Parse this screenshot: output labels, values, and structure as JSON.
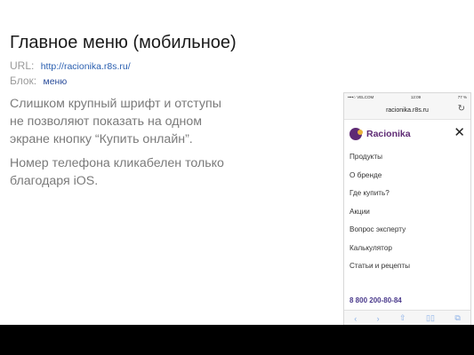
{
  "slide": {
    "title": "Главное меню (мобильное)",
    "url_label": "URL:",
    "url_value": "http://racionika.r8s.ru/",
    "block_label": "Блок:",
    "block_value": "меню",
    "paragraph1": "Слишком крупный шрифт и отступы не позволяют показать на одном экране кнопку “Купить онлайн”.",
    "paragraph2": "Номер телефона кликабелен только благодаря iOS."
  },
  "phone": {
    "status_left": "••••○ VELCOM",
    "status_time": "12:09",
    "status_right": "77 %",
    "domain": "racionika.r8s.ru",
    "brand_name": "Racionika",
    "menu": [
      {
        "label": "Продукты"
      },
      {
        "label": "О бренде"
      },
      {
        "label": "Где купить?"
      },
      {
        "label": "Акции"
      },
      {
        "label": "Вопрос эксперту"
      },
      {
        "label": "Калькулятор"
      },
      {
        "label": "Статьи и рецепты"
      }
    ],
    "phone_number": "8 800 200-80-84",
    "icons": [
      "reload-icon",
      "close-icon",
      "back-icon",
      "forward-icon",
      "share-icon",
      "bookmarks-icon",
      "tabs-icon"
    ],
    "colors": {
      "brand": "#5e2a74",
      "logo_dot": "#e8b23b",
      "link": "#2a5fb0"
    }
  }
}
